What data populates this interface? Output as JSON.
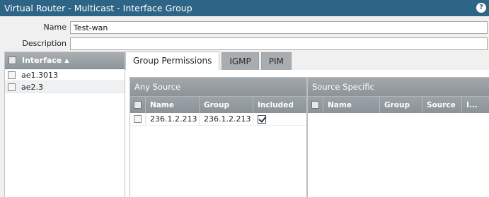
{
  "window": {
    "title": "Virtual Router - Multicast - Interface Group",
    "help_icon": "?"
  },
  "form": {
    "name_label": "Name",
    "name_value": "Test-wan",
    "description_label": "Description",
    "description_value": ""
  },
  "interfaces": {
    "header": "Interface",
    "sort_icon": "sort-ascending-icon",
    "rows": [
      {
        "name": "ae1.3013"
      },
      {
        "name": "ae2.3"
      }
    ]
  },
  "tabs": [
    {
      "label": "Group Permissions",
      "active": true
    },
    {
      "label": "IGMP",
      "active": false
    },
    {
      "label": "PIM",
      "active": false
    }
  ],
  "any_source": {
    "title": "Any Source",
    "columns": [
      "Name",
      "Group",
      "Included"
    ],
    "rows": [
      {
        "name": "236.1.2.213",
        "group": "236.1.2.213",
        "included": true
      }
    ]
  },
  "source_specific": {
    "title": "Source Specific",
    "columns": [
      "Name",
      "Group",
      "Source",
      "I..."
    ],
    "rows": []
  },
  "colors": {
    "titlebar": "#2e6587",
    "header_gray": "#9aa1a6"
  }
}
